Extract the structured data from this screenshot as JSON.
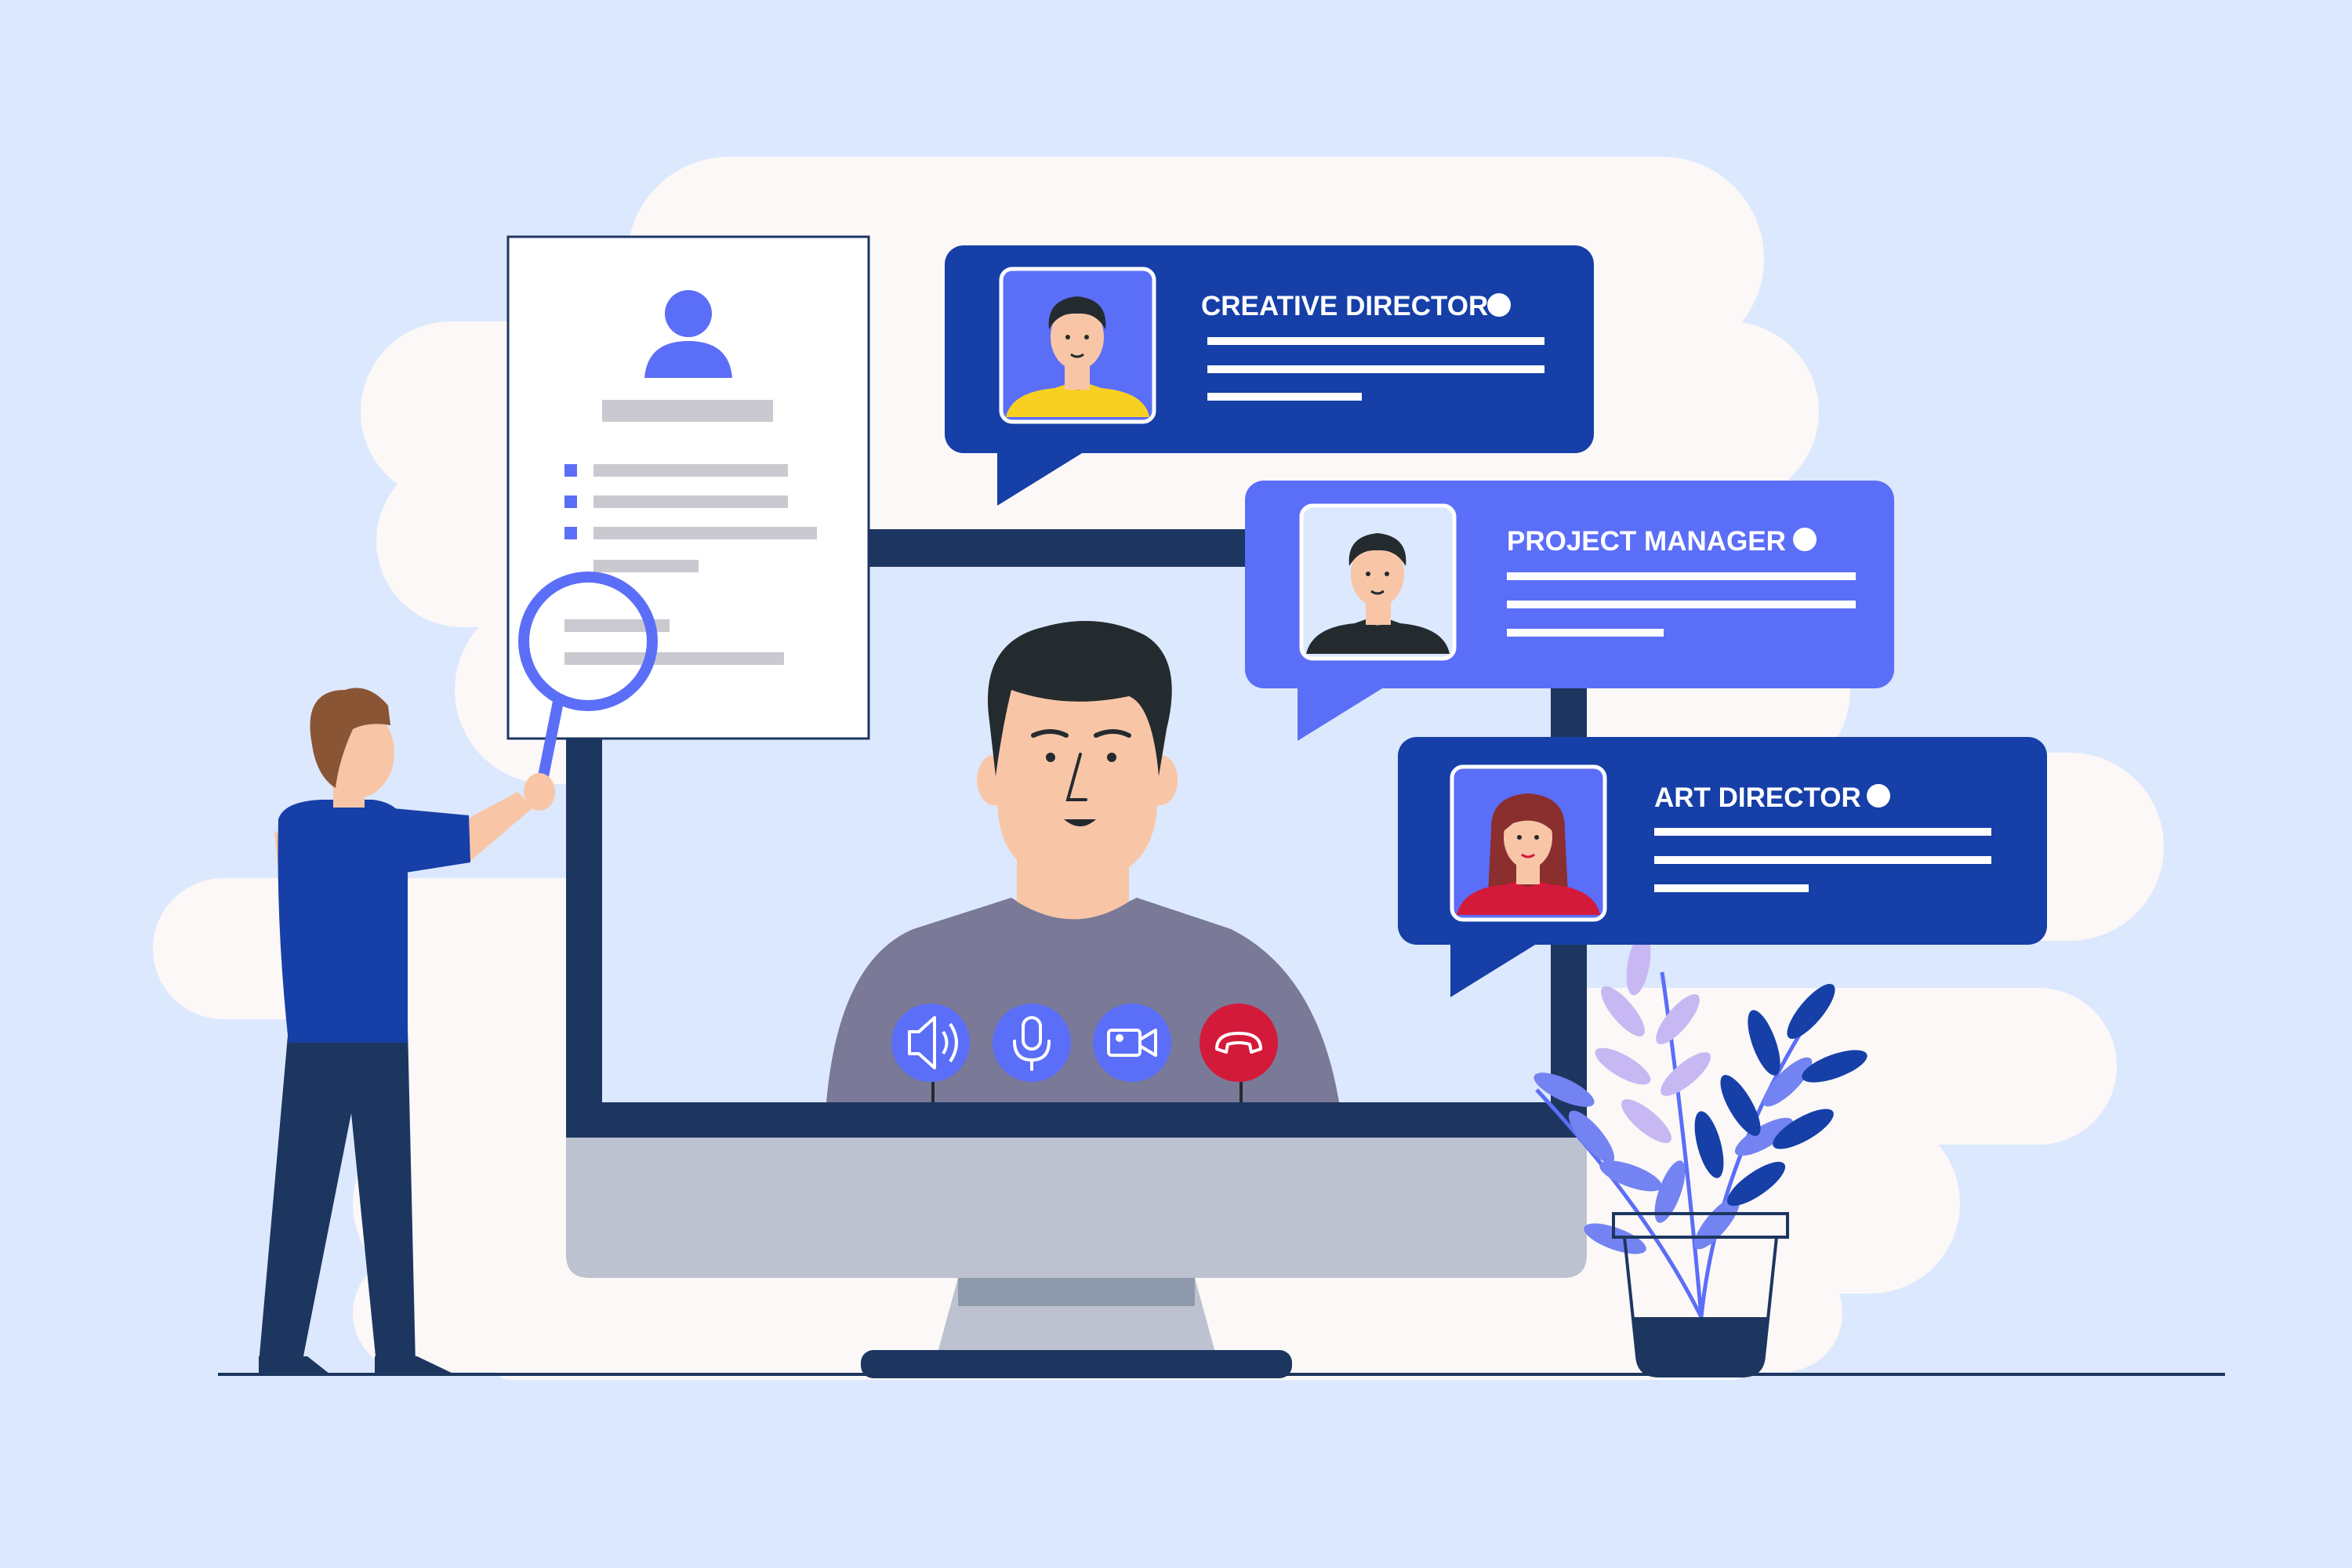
{
  "colors": {
    "background": "#dce8fd",
    "cloud": "#fbf8f7",
    "navy": "#1d3660",
    "royal_blue": "#163fa8",
    "periwinkle": "#5b6ef8",
    "call_end_red": "#d41a3a",
    "skin": "#f8c6a7",
    "hair_dark": "#242b2f",
    "monitor_stand": "#bcc2cf"
  },
  "candidates": [
    {
      "title": "CREATIVE DIRECTOR",
      "status_icon": "online-dot-icon",
      "avatar": "man-yellow-shirt-avatar"
    },
    {
      "title": "PROJECT MANAGER",
      "status_icon": "online-dot-icon",
      "avatar": "man-black-shirt-avatar"
    },
    {
      "title": "ART DIRECTOR",
      "status_icon": "online-dot-icon",
      "avatar": "woman-red-shirt-avatar"
    }
  ],
  "call_controls": [
    {
      "icon": "speaker-icon",
      "color": "#5b6ef8"
    },
    {
      "icon": "microphone-icon",
      "color": "#5b6ef8"
    },
    {
      "icon": "video-camera-icon",
      "color": "#5b6ef8"
    },
    {
      "icon": "end-call-icon",
      "color": "#d41a3a"
    }
  ]
}
